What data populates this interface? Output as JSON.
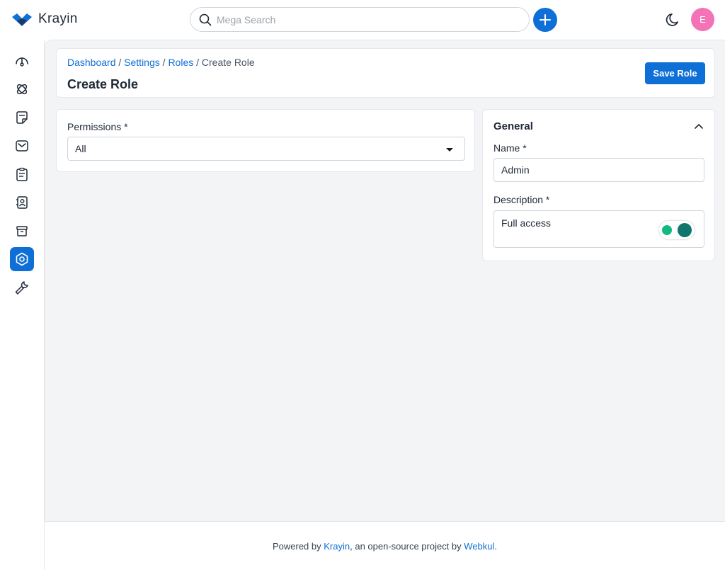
{
  "header": {
    "brand": "Krayin",
    "search_placeholder": "Mega Search",
    "avatar_initial": "E"
  },
  "sidebar": {
    "items": [
      {
        "name": "dashboard-icon"
      },
      {
        "name": "leads-icon"
      },
      {
        "name": "quotes-icon"
      },
      {
        "name": "mail-icon"
      },
      {
        "name": "activities-icon"
      },
      {
        "name": "contacts-icon"
      },
      {
        "name": "products-icon"
      },
      {
        "name": "settings-icon",
        "active": true
      },
      {
        "name": "configuration-icon"
      }
    ]
  },
  "page": {
    "breadcrumb": [
      "Dashboard",
      "Settings",
      "Roles",
      "Create Role"
    ],
    "title": "Create Role",
    "save_label": "Save Role"
  },
  "permissions": {
    "label": "Permissions *",
    "value": "All"
  },
  "general": {
    "title": "General",
    "name_label": "Name *",
    "name_value": "Admin",
    "description_label": "Description *",
    "description_value": "Full access"
  },
  "footer": {
    "prefix": "Powered by ",
    "krayin_link": "Krayin",
    "middle": ", an open-source project by ",
    "webkul_link": "Webkul",
    "suffix": "."
  },
  "colors": {
    "accent": "#0e6fd6",
    "avatar": "#f472b6"
  }
}
